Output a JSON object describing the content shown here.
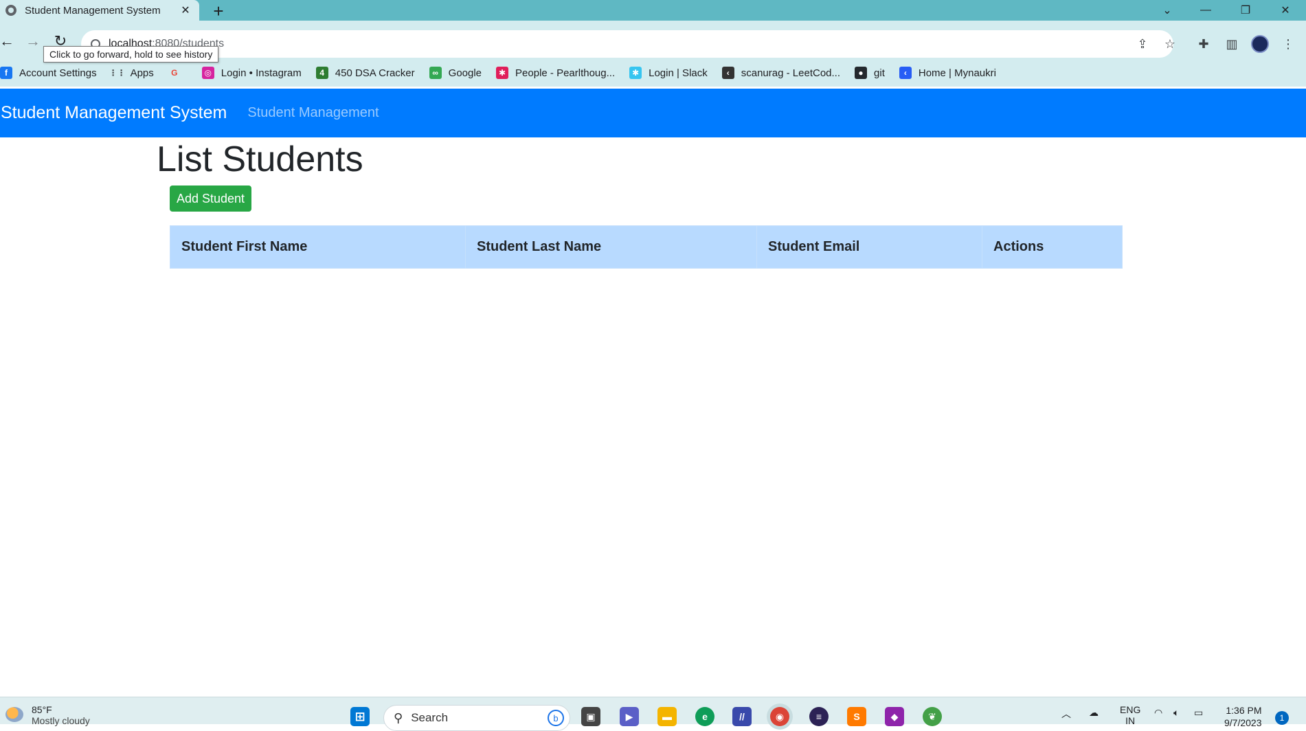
{
  "browser": {
    "tab_title": "Student Management System",
    "tab_close": "✕",
    "new_tab": "+",
    "url_host": "localhost",
    "url_rest": ":8080/students",
    "tooltip": "Click to go forward, hold to see history"
  },
  "bookmarks": [
    {
      "label": "Account Settings",
      "icon": "facebook-icon",
      "color": "#1877f2",
      "glyph": "f"
    },
    {
      "label": "Apps",
      "icon": "apps-grid-icon",
      "color": "#3c4043",
      "glyph": "⋮⋮"
    },
    {
      "label": "",
      "icon": "google-icon",
      "color": "#ea4335",
      "glyph": "G"
    },
    {
      "label": "Login • Instagram",
      "icon": "instagram-icon",
      "color": "#d6249f",
      "glyph": "◎"
    },
    {
      "label": "450 DSA Cracker",
      "icon": "dsa-icon",
      "color": "#2e7d32",
      "glyph": "4"
    },
    {
      "label": "Google",
      "icon": "google-bookmark-icon",
      "color": "#34a853",
      "glyph": "∞"
    },
    {
      "label": "People - Pearlthoug...",
      "icon": "slack-icon",
      "color": "#e01e5a",
      "glyph": "✱"
    },
    {
      "label": "Login | Slack",
      "icon": "slack-login-icon",
      "color": "#36c5f0",
      "glyph": "✱"
    },
    {
      "label": "scanurag - LeetCod...",
      "icon": "leetcode-icon",
      "color": "#333333",
      "glyph": "‹"
    },
    {
      "label": "git",
      "icon": "github-icon",
      "color": "#24292e",
      "glyph": "●"
    },
    {
      "label": "Home | Mynaukri",
      "icon": "naukri-icon",
      "color": "#275df5",
      "glyph": "‹"
    }
  ],
  "app": {
    "brand": "Student Management System",
    "nav_link": "Student Management",
    "page_title": "List Students",
    "add_button": "Add Student",
    "columns": [
      "Student First Name",
      "Student Last Name",
      "Student Email",
      "Actions"
    ]
  },
  "taskbar": {
    "temp": "85°F",
    "condition": "Mostly cloudy",
    "search_placeholder": "Search",
    "lang_line1": "ENG",
    "lang_line2": "IN",
    "time": "1:36 PM",
    "date": "9/7/2023",
    "notifications": "1"
  },
  "colors": {
    "navbar": "#007bff",
    "add_button": "#28a745",
    "table_header": "#b8daff",
    "tab_strip": "#5fb8c3"
  }
}
